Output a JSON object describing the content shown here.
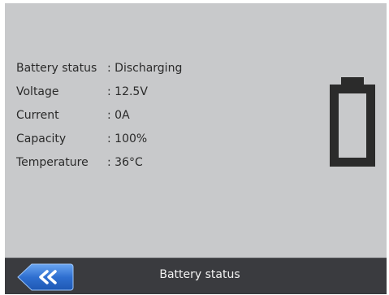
{
  "status_panel": {
    "rows": [
      {
        "label": "Battery status",
        "value": ": Discharging"
      },
      {
        "label": "Voltage",
        "value": ": 12.5V"
      },
      {
        "label": "Current",
        "value": ": 0A"
      },
      {
        "label": "Capacity",
        "value": ": 100%"
      },
      {
        "label": "Temperature",
        "value": ": 36°C"
      }
    ]
  },
  "battery_icon": {
    "icon": "battery-icon",
    "color": "#2b2b2b"
  },
  "bottom_bar": {
    "back_icon": "double-chevron-left-icon",
    "title": "Battery status",
    "accent": "#2f6fd0"
  }
}
